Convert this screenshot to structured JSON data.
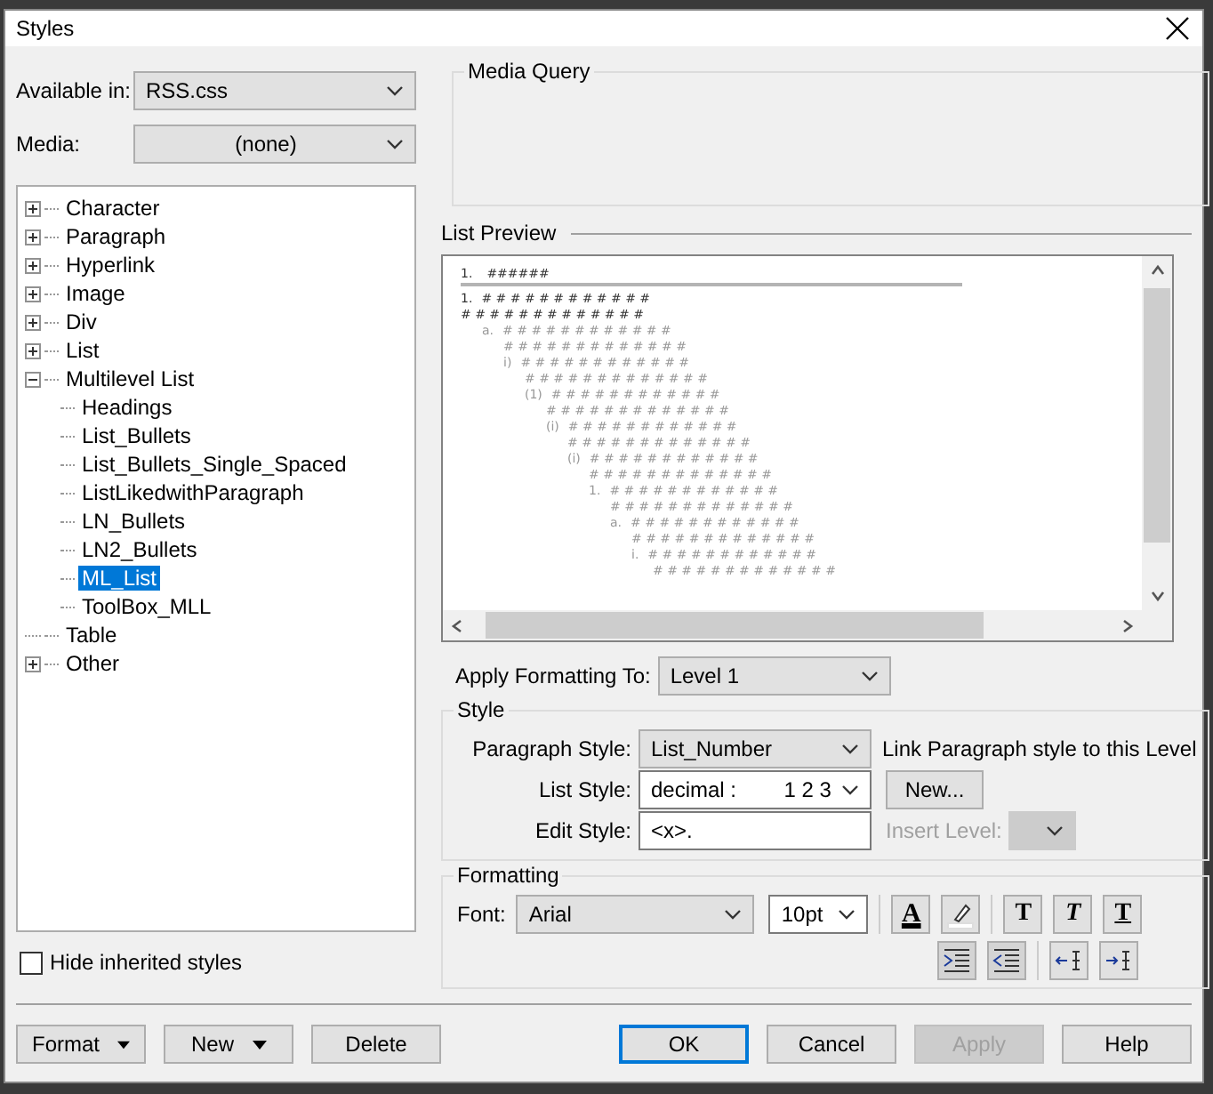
{
  "window": {
    "title": "Styles"
  },
  "available_in": {
    "label": "Available in:",
    "value": "RSS.css"
  },
  "media": {
    "label": "Media:",
    "value": "(none)"
  },
  "media_query": {
    "label": "Media Query"
  },
  "tree": [
    {
      "label": "Character",
      "expanded": false,
      "selected": false
    },
    {
      "label": "Paragraph",
      "expanded": false,
      "selected": false
    },
    {
      "label": "Hyperlink",
      "expanded": false,
      "selected": false
    },
    {
      "label": "Image",
      "expanded": false,
      "selected": false
    },
    {
      "label": "Div",
      "expanded": false,
      "selected": false
    },
    {
      "label": "List",
      "expanded": false,
      "selected": false
    },
    {
      "label": "Multilevel List",
      "expanded": true,
      "selected": false,
      "children": [
        {
          "label": "Headings",
          "selected": false
        },
        {
          "label": "List_Bullets",
          "selected": false
        },
        {
          "label": "List_Bullets_Single_Spaced",
          "selected": false
        },
        {
          "label": "ListLikedwithParagraph",
          "selected": false
        },
        {
          "label": "LN_Bullets",
          "selected": false
        },
        {
          "label": "LN2_Bullets",
          "selected": false
        },
        {
          "label": "ML_List",
          "selected": true
        },
        {
          "label": "ToolBox_MLL",
          "selected": false
        }
      ]
    },
    {
      "label": "Table",
      "selected": false
    },
    {
      "label": "Other",
      "expanded": false,
      "selected": false
    }
  ],
  "hide_inherited": {
    "label": "Hide inherited styles",
    "checked": false
  },
  "preview": {
    "title": "List Preview",
    "heading": {
      "marker": "1.",
      "text": "######"
    },
    "items": [
      {
        "marker": "1.",
        "text": "# # # # # # # # # # # #",
        "more": "# # # # # # # # # # # # #",
        "children": [
          {
            "marker": "a.",
            "text": "# # # # # # # # # # # #",
            "more": "# # # # # # # # # # # # #",
            "children": [
              {
                "marker": "i)",
                "text": "# # # # # # # # # # # #",
                "more": "# # # # # # # # # # # # #",
                "children": [
                  {
                    "marker": "(1)",
                    "text": "# # # # # # # # # # # #",
                    "more": "# # # # # # # # # # # # #",
                    "children": [
                      {
                        "marker": "(i)",
                        "text": "# # # # # # # # # # # #",
                        "more": "# # # # # # # # # # # # #",
                        "children": [
                          {
                            "marker": "(i)",
                            "text": "# # # # # # # # # # # #",
                            "more": "# # # # # # # # # # # # #",
                            "children": [
                              {
                                "marker": "1.",
                                "text": "# # # # # # # # # # # #",
                                "more": "# # # # # # # # # # # # #",
                                "children": [
                                  {
                                    "marker": "a.",
                                    "text": "# # # # # # # # # # # #",
                                    "more": "# # # # # # # # # # # # #",
                                    "children": [
                                      {
                                        "marker": "i.",
                                        "text": "# # # # # # # # # # # #",
                                        "more": "# # # # # # # # # # # # #"
                                      }
                                    ]
                                  }
                                ]
                              }
                            ]
                          }
                        ]
                      }
                    ]
                  }
                ]
              }
            ]
          }
        ]
      }
    ]
  },
  "apply_to": {
    "label": "Apply Formatting To:",
    "value": "Level 1"
  },
  "style": {
    "title": "Style",
    "paragraph_style": {
      "label": "Paragraph Style:",
      "value": "List_Number"
    },
    "link_label": "Link Paragraph style to this Level",
    "list_style": {
      "label": "List Style:",
      "value": "decimal :        1 2 3"
    },
    "new_button": "New...",
    "edit_style": {
      "label": "Edit Style:",
      "value": "<x>."
    },
    "insert_level": {
      "label": "Insert Level:",
      "disabled": true
    }
  },
  "formatting": {
    "title": "Formatting",
    "font": {
      "label": "Font:",
      "value": "Arial"
    },
    "size": {
      "value": "10pt"
    },
    "tools": [
      {
        "kind": "color",
        "glyph": "A"
      },
      {
        "kind": "highlight"
      },
      {
        "kind": "bold",
        "glyph": "T"
      },
      {
        "kind": "italic",
        "glyph": "T"
      },
      {
        "kind": "underline",
        "glyph": "T"
      }
    ],
    "tools2": [
      {
        "kind": "indent-in"
      },
      {
        "kind": "indent-out"
      },
      {
        "kind": "level-left"
      },
      {
        "kind": "level-right"
      }
    ]
  },
  "buttons_left": [
    {
      "label": "Format",
      "menu": true
    },
    {
      "label": "New",
      "menu": true
    },
    {
      "label": "Delete",
      "menu": false
    }
  ],
  "buttons_right": [
    {
      "label": "OK",
      "default": true,
      "disabled": false
    },
    {
      "label": "Cancel",
      "default": false,
      "disabled": false
    },
    {
      "label": "Apply",
      "default": false,
      "disabled": true
    },
    {
      "label": "Help",
      "default": false,
      "disabled": false
    }
  ]
}
